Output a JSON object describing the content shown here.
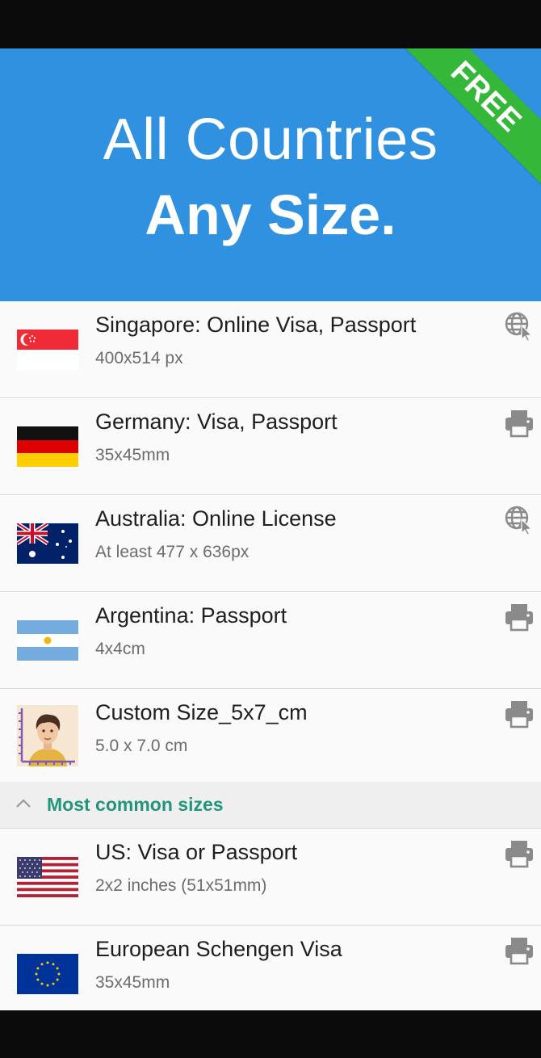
{
  "banner": {
    "line1": "All Countries",
    "line2": "Any Size.",
    "ribbon": "FREE",
    "color": "#2f91df",
    "ribbon_color": "#35b739"
  },
  "items": [
    {
      "title": "Singapore: Online Visa, Passport",
      "subtitle": "400x514 px",
      "flag": "singapore-flag",
      "action": "globe-cursor-icon"
    },
    {
      "title": "Germany: Visa, Passport",
      "subtitle": "35x45mm",
      "flag": "germany-flag",
      "action": "printer-icon"
    },
    {
      "title": "Australia: Online License",
      "subtitle": "At least 477 x 636px",
      "flag": "australia-flag",
      "action": "globe-cursor-icon"
    },
    {
      "title": "Argentina: Passport",
      "subtitle": "4x4cm",
      "flag": "argentina-flag",
      "action": "printer-icon"
    },
    {
      "title": "Custom Size_5x7_cm",
      "subtitle": "5.0 x 7.0 cm",
      "flag": "custom-portrait-icon",
      "action": "printer-icon"
    }
  ],
  "section": {
    "label": "Most common sizes",
    "color": "#22957c"
  },
  "common_items": [
    {
      "title": "US: Visa or Passport",
      "subtitle": "2x2 inches (51x51mm)",
      "flag": "usa-flag",
      "action": "printer-icon"
    },
    {
      "title": "European Schengen Visa",
      "subtitle": "35x45mm",
      "flag": "eu-flag",
      "action": "printer-icon"
    }
  ]
}
